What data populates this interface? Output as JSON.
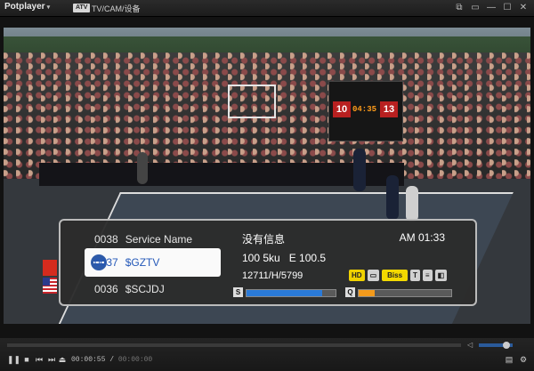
{
  "window": {
    "app_name": "Potplayer",
    "badge": "ATV",
    "title": "TV/CAM/设备",
    "buttons": [
      "⧉",
      "▭",
      "—",
      "☐",
      "✕"
    ]
  },
  "scoreboard": {
    "home": "10",
    "clock": "04:35",
    "away": "13"
  },
  "osd": {
    "channels": [
      {
        "number": "0038",
        "name": "Service Name"
      },
      {
        "number": "0037",
        "name": "$GZTV"
      },
      {
        "number": "0036",
        "name": "$SCJDJ"
      }
    ],
    "selected_index": 1,
    "message": "没有信息",
    "time": "AM 01:33",
    "frequency": "100 5ku",
    "epg_value": "E 100.5",
    "transponder": "12711/H/5799",
    "tags": [
      "HD",
      "Biss"
    ],
    "signal_label": "S",
    "signal_strength": 0.85,
    "quality_label": "Q",
    "signal_quality": 0.17,
    "signal_color": "#2a7ad8",
    "quality_color": "#f39a1b"
  },
  "playback": {
    "position": "00:00:55",
    "duration": "00:00:00",
    "volume": 0.7
  }
}
